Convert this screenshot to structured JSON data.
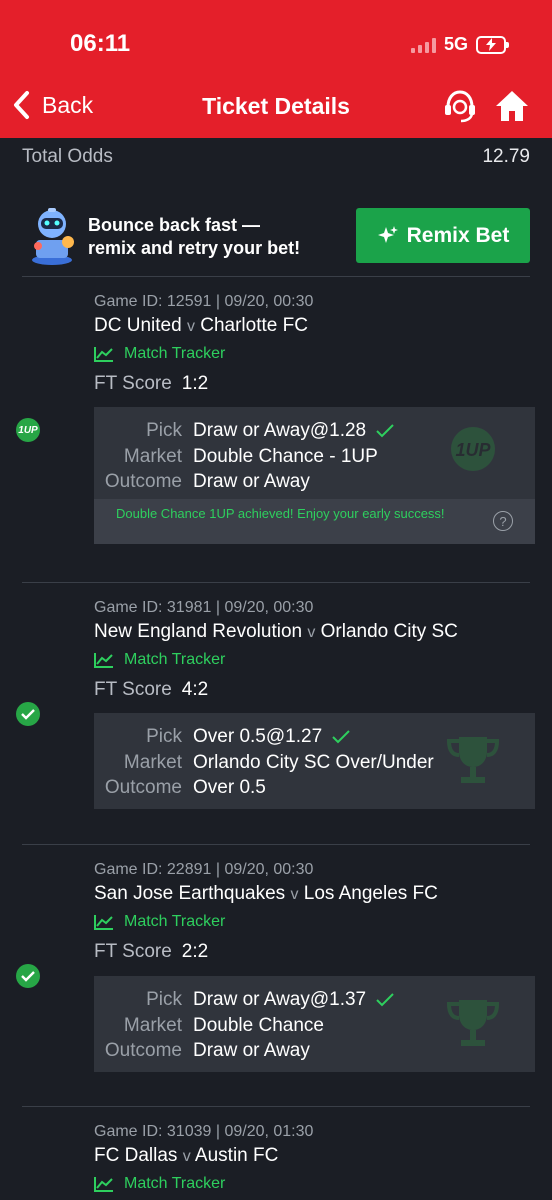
{
  "status_bar": {
    "time": "06:11",
    "network": "5G"
  },
  "nav": {
    "back_label": "Back",
    "title": "Ticket Details"
  },
  "ticket": {
    "total_odds_label": "Total Odds",
    "total_odds_value": "12.79"
  },
  "promo": {
    "line1": "Bounce back fast —",
    "line2": "remix and retry your bet!",
    "button_label": "Remix Bet"
  },
  "labels": {
    "tracker": "Match Tracker",
    "ft_score": "FT Score",
    "pick": "Pick",
    "market": "Market",
    "outcome": "Outcome",
    "vs": "v",
    "oneup_badge": "1UP"
  },
  "matches": [
    {
      "game_id": "Game ID: 12591 | 09/20, 00:30",
      "home": "DC United",
      "away": "Charlotte FC",
      "ft_score": "1:2",
      "pick": "Draw or Away@1.28",
      "market": "Double Chance - 1UP",
      "outcome": "Draw or Away",
      "note": "Double Chance 1UP achieved! Enjoy your early success!",
      "status": "1up"
    },
    {
      "game_id": "Game ID: 31981 | 09/20, 00:30",
      "home": "New England Revolution",
      "away": "Orlando City SC",
      "ft_score": "4:2",
      "pick": "Over 0.5@1.27",
      "market": "Orlando City SC Over/Under",
      "outcome": "Over 0.5",
      "status": "won"
    },
    {
      "game_id": "Game ID: 22891 | 09/20, 00:30",
      "home": "San Jose Earthquakes",
      "away": "Los Angeles FC",
      "ft_score": "2:2",
      "pick": "Draw or Away@1.37",
      "market": "Double Chance",
      "outcome": "Draw or Away",
      "status": "won"
    },
    {
      "game_id": "Game ID: 31039 | 09/20, 01:30",
      "home": "FC Dallas",
      "away": "Austin FC"
    }
  ],
  "colors": {
    "header": "#e41f2a",
    "background": "#1b1e25",
    "accent_green": "#2ecf5e",
    "button_green": "#1ba34a"
  }
}
